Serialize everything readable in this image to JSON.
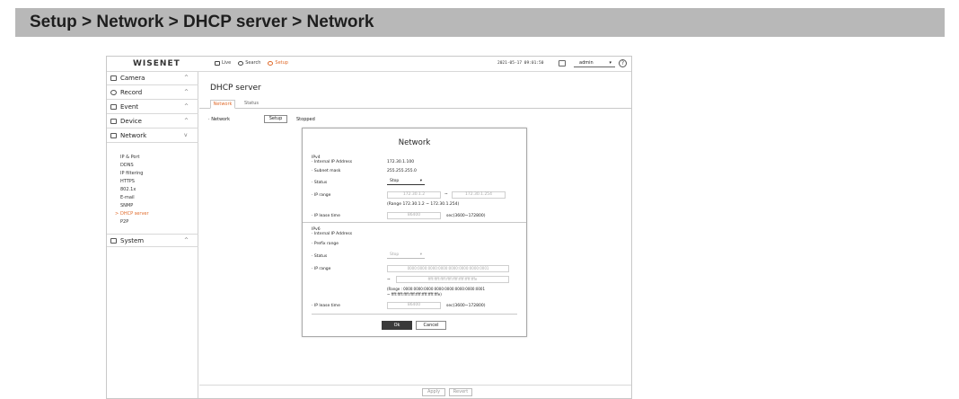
{
  "banner": {
    "title": "Setup > Network > DHCP server > Network"
  },
  "topbar": {
    "logo": "WISENET",
    "nav": [
      {
        "label": "Live",
        "icon": "monitor-icon"
      },
      {
        "label": "Search",
        "icon": "search-icon"
      },
      {
        "label": "Setup",
        "icon": "gear-icon"
      }
    ],
    "datetime": "2021-05-17 09:01:50",
    "user": "admin",
    "help": "?"
  },
  "sidebar": {
    "menus": [
      {
        "label": "Camera",
        "icon": "camera-icon",
        "chevron": "^"
      },
      {
        "label": "Record",
        "icon": "record-icon",
        "chevron": "^"
      },
      {
        "label": "Event",
        "icon": "bell-icon",
        "chevron": "^"
      },
      {
        "label": "Device",
        "icon": "device-icon",
        "chevron": "^"
      },
      {
        "label": "Network",
        "icon": "network-icon",
        "chevron": "v"
      },
      {
        "label": "System",
        "icon": "system-icon",
        "chevron": "^"
      }
    ],
    "network_items": [
      "IP & Port",
      "DDNS",
      "IP filtering",
      "HTTPS",
      "802.1x",
      "E-mail",
      "SNMP",
      "DHCP server",
      "P2P"
    ],
    "active_item_bullet": ">"
  },
  "main": {
    "title": "DHCP server",
    "tabs": [
      "Network",
      "Status"
    ],
    "network_label": "Network",
    "setup_button": "Setup",
    "status_text": "Stopped",
    "apply_button": "Apply",
    "revert_button": "Revert"
  },
  "dialog": {
    "title": "Network",
    "ipv4": {
      "heading": "IPv4",
      "internal_ip_label": "Internal IP Address",
      "internal_ip_value": "172.30.1.100",
      "subnet_label": "Subnet mask",
      "subnet_value": "255.255.255.0",
      "status_label": "Status",
      "status_value": "Stop",
      "ip_range_label": "IP range",
      "ip_range_start": "172.30.1.2",
      "ip_range_sep": "~",
      "ip_range_end": "172.30.1.254",
      "ip_range_hint": "(Range 172.30.1.2 ~ 172.30.1.254)",
      "lease_label": "IP lease time",
      "lease_value": "86400",
      "lease_unit": "sec(3600~172800)"
    },
    "ipv6": {
      "heading": "IPv6",
      "internal_ip_label": "Internal IP Address",
      "prefix_label": "Prefix range",
      "status_label": "Status",
      "status_value": "Stop",
      "ip_range_label": "IP range",
      "ip_range_start": "0000:0000:0000:0000:0000:0000:0000:0001",
      "ip_range_sep": "~",
      "ip_range_end": "ffff:ffff:ffff:ffff:ffff:ffff:ffff:fffe",
      "ip_range_hint_1": "(Range : 0000:0000:0000:0000:0000:0000:0000:0001",
      "ip_range_hint_2": "~ ffff:ffff:ffff:ffff:ffff:ffff:ffff:fffe)",
      "lease_label": "IP lease time",
      "lease_value": "86400",
      "lease_unit": "sec(3600~172800)"
    },
    "ok_button": "Ok",
    "cancel_button": "Cancel"
  },
  "colors": {
    "accent": "#e06a2a",
    "banner": "#b8b8b8",
    "ok_button": "#3a3a3a"
  }
}
